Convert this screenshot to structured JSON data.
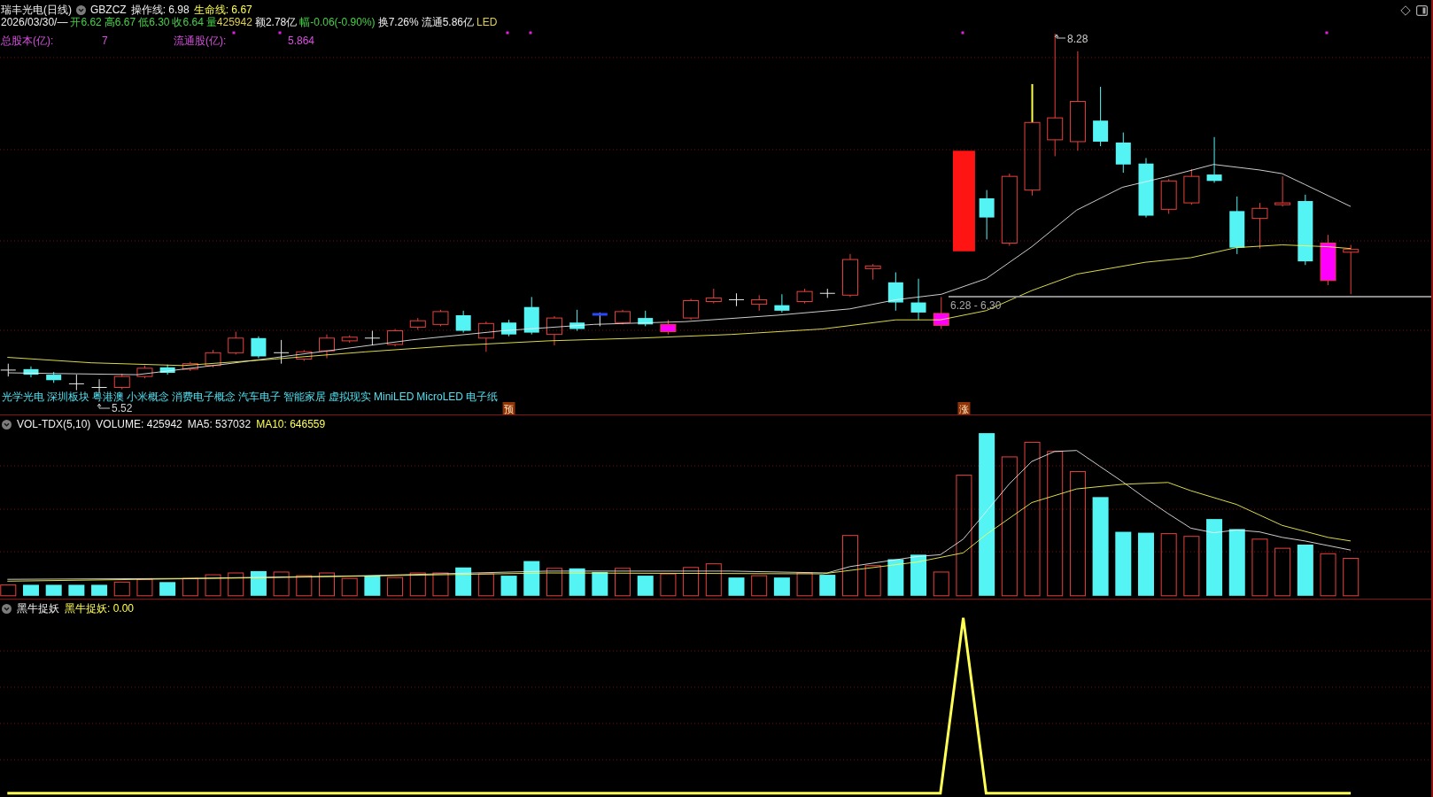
{
  "header": {
    "title": "瑞丰光电(日线)",
    "code": "GBZCZ",
    "lines": [
      {
        "text": "操作线: 6.98",
        "color": "#f0f0f0"
      },
      {
        "text": "生命线: 6.67",
        "color": "#ffff54"
      }
    ]
  },
  "quote": {
    "date": "2026/03/30/—",
    "fields": [
      {
        "label": "开",
        "value": "6.62",
        "kind": "down"
      },
      {
        "label": "高",
        "value": "6.67",
        "kind": "down"
      },
      {
        "label": "低",
        "value": "6.30",
        "kind": "down"
      },
      {
        "label": "收",
        "value": "6.64",
        "kind": "down"
      },
      {
        "label": "量",
        "value": "425942",
        "kind": "volume"
      },
      {
        "label": "额",
        "value": "2.78亿",
        "kind": "plain"
      },
      {
        "label": "幅",
        "value": "-0.06(-0.90%)",
        "kind": "down"
      },
      {
        "label": "换",
        "value": "7.26%",
        "kind": "plain"
      },
      {
        "label": "流通",
        "value": "5.86亿",
        "kind": "plain"
      },
      {
        "value": "LED",
        "kind": "sector"
      }
    ]
  },
  "share_info": [
    {
      "label": "总股本(亿):",
      "value": "7"
    },
    {
      "label": "流通股(亿):",
      "value": "5.864"
    }
  ],
  "price_chart": {
    "concepts": [
      "光学光电",
      "深圳板块",
      "粤港澳",
      "小米概念",
      "消费电子概念",
      "汽车电子",
      "智能家居",
      "虚拟现实",
      "MiniLED",
      "MicroLED",
      "电子纸"
    ],
    "high_label": "8.28",
    "low_label": "5.52",
    "range_label": "6.28 - 6.30",
    "signals": [
      "预",
      "涨"
    ]
  },
  "volume_panel": {
    "title": "VOL-TDX(5,10)",
    "readings": [
      {
        "text": "VOLUME: 425942",
        "color": "#f0f0f0"
      },
      {
        "text": "MA5: 537032",
        "color": "#f0f0f0"
      },
      {
        "text": "MA10: 646559",
        "color": "#ffff54"
      }
    ]
  },
  "indicator_panel": {
    "title": "黑牛捉妖",
    "readings": [
      {
        "text": "黑牛捉妖: 0.00",
        "color": "#ffff54"
      }
    ]
  }
}
